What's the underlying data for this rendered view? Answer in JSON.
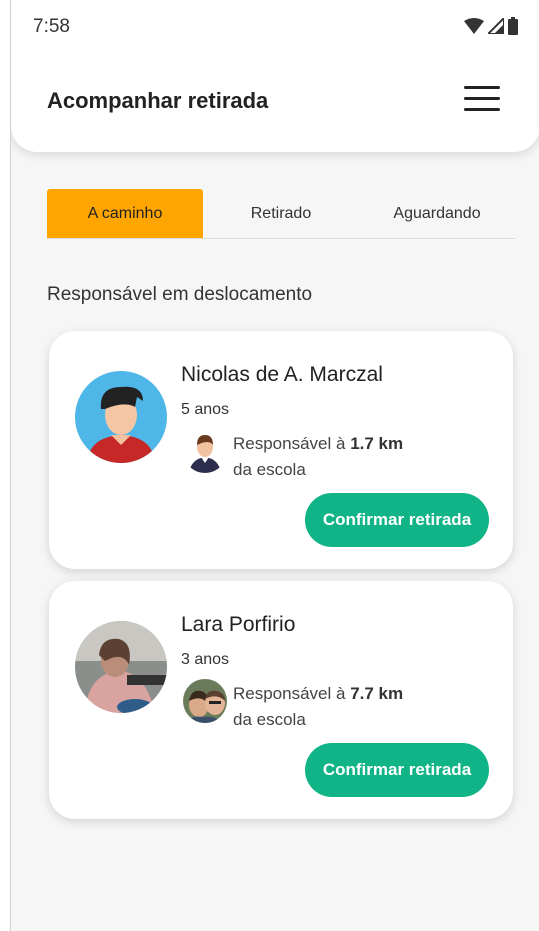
{
  "status_bar": {
    "time": "7:58",
    "icons": [
      "wifi-icon",
      "signal-icon",
      "battery-icon"
    ]
  },
  "header": {
    "title": "Acompanhar retirada",
    "menu_icon": "hamburger-menu-icon"
  },
  "tabs": [
    {
      "label": "A caminho",
      "active": true
    },
    {
      "label": "Retirado",
      "active": false
    },
    {
      "label": "Aguardando",
      "active": false
    }
  ],
  "section_label": "Responsável em deslocamento",
  "cards": [
    {
      "name": "Nicolas de A. Marczal",
      "age": "5 anos",
      "resp_prefix": "Responsável à",
      "distance": "1.7 km",
      "resp_suffix": "da escola",
      "button": "Confirmar retirada"
    },
    {
      "name": "Lara Porfirio",
      "age": "3 anos",
      "resp_prefix": "Responsável à",
      "distance": "7.7 km",
      "resp_suffix": "da escola",
      "button": "Confirmar retirada"
    }
  ],
  "colors": {
    "accent": "#ffa500",
    "button": "#10b486"
  }
}
